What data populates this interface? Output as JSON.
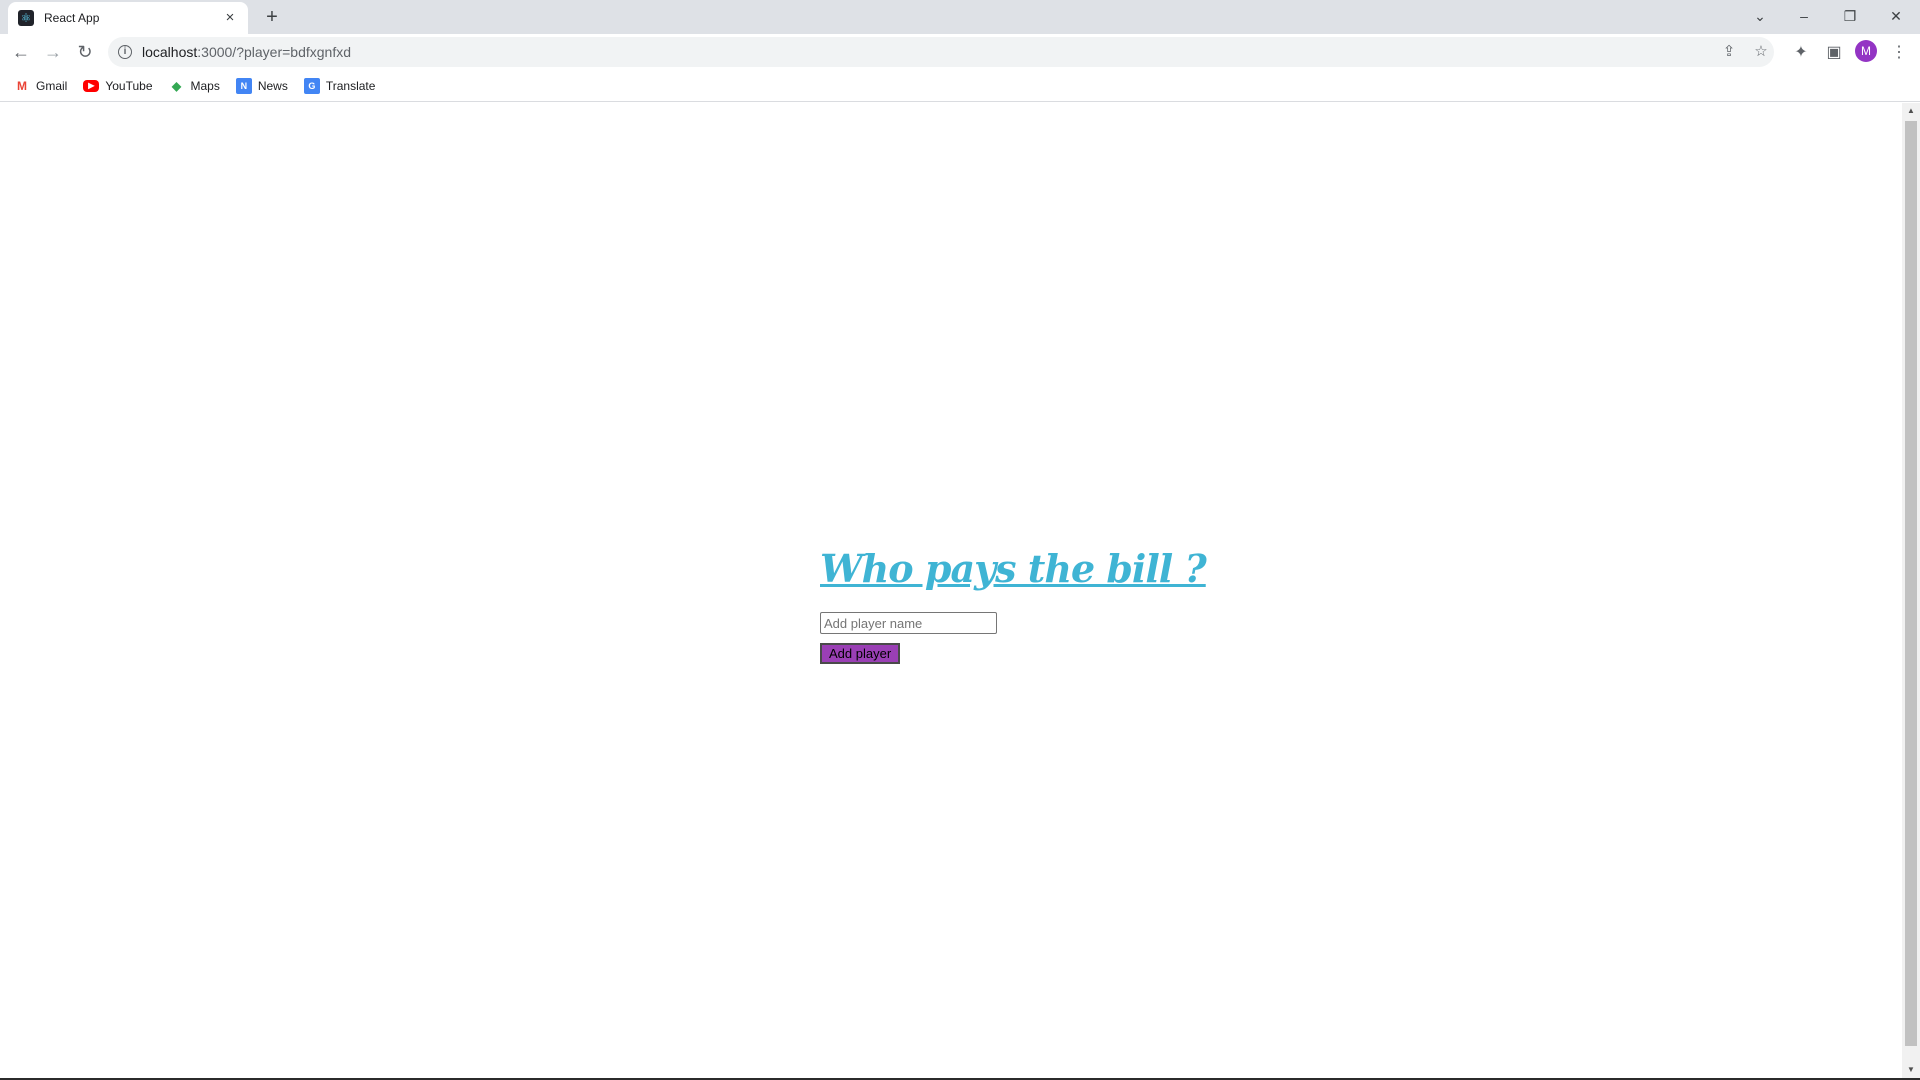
{
  "browser": {
    "tab": {
      "title": "React App",
      "favicon": "react-logo-icon",
      "close_label": "×"
    },
    "new_tab_label": "+",
    "window_controls": {
      "tab_search": "⌄",
      "minimize": "–",
      "restore": "❐",
      "close": "✕"
    },
    "nav": {
      "back": "←",
      "forward": "→",
      "reload": "↻"
    },
    "url": {
      "host": "localhost",
      "rest": ":3000/?player=bdfxgnfxd"
    },
    "avatar_letter": "M",
    "bookmarks": [
      {
        "label": "Gmail",
        "icon": "gmail-icon",
        "glyph": "M"
      },
      {
        "label": "YouTube",
        "icon": "youtube-icon",
        "glyph": "▶"
      },
      {
        "label": "Maps",
        "icon": "maps-icon",
        "glyph": "◆"
      },
      {
        "label": "News",
        "icon": "news-icon",
        "glyph": "N"
      },
      {
        "label": "Translate",
        "icon": "translate-icon",
        "glyph": "G"
      }
    ]
  },
  "app": {
    "title": "Who pays the bill ?",
    "input_placeholder": "Add player name",
    "input_value": "",
    "add_button_label": "Add player",
    "accent_color": "#3fb4d4",
    "button_color": "#9a3fb5"
  }
}
